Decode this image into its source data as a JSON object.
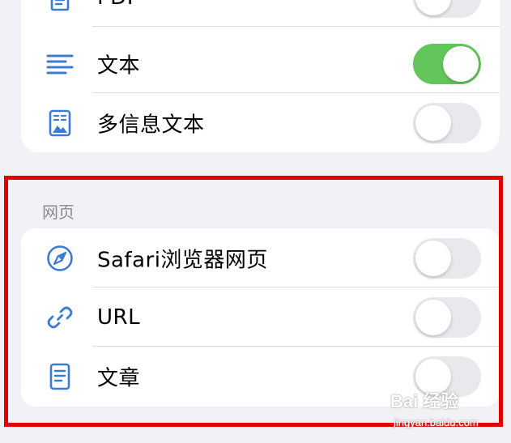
{
  "formats_section": {
    "items": [
      {
        "label": "PDF",
        "icon": "pdf-document-icon",
        "toggle": false
      },
      {
        "label": "文本",
        "icon": "text-lines-icon",
        "toggle": true
      },
      {
        "label": "多信息文本",
        "icon": "rich-text-icon",
        "toggle": false
      }
    ]
  },
  "web_section": {
    "header": "网页",
    "items": [
      {
        "label": "Safari浏览器网页",
        "icon": "safari-compass-icon",
        "toggle": false
      },
      {
        "label": "URL",
        "icon": "link-icon",
        "toggle": false
      },
      {
        "label": "文章",
        "icon": "article-icon",
        "toggle": false
      }
    ]
  },
  "colors": {
    "accent": "#3a7bd5",
    "toggle_on": "#63c65a",
    "toggle_off": "#e8e8ed",
    "highlight": "#e00000",
    "background": "#f2f2f6"
  },
  "watermark": {
    "main": "Bai 经验",
    "sub": "jingyan.baidu.com"
  }
}
